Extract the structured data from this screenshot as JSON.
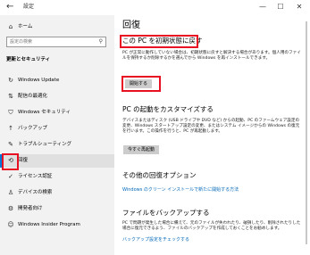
{
  "window": {
    "title": "設定",
    "back_glyph": "←",
    "minimize_glyph": "—",
    "maximize_glyph": "☐",
    "close_glyph": "✕"
  },
  "sidebar": {
    "home": {
      "label": "ホーム",
      "icon": "home-icon",
      "glyph": "⌂"
    },
    "search": {
      "placeholder": "設定の検索",
      "icon": "search-icon",
      "glyph": "⚲"
    },
    "section_title": "更新とセキュリティ",
    "items": [
      {
        "label": "Windows Update",
        "icon": "sync-icon",
        "glyph": "↻"
      },
      {
        "label": "配信の最適化",
        "icon": "delivery-optimization-icon",
        "glyph": "⇅"
      },
      {
        "label": "Windows セキュリティ",
        "icon": "shield-icon",
        "glyph": "⛉"
      },
      {
        "label": "バックアップ",
        "icon": "backup-arrow-icon",
        "glyph": "↑"
      },
      {
        "label": "トラブルシューティング",
        "icon": "wrench-icon",
        "glyph": "✎"
      },
      {
        "label": "回復",
        "icon": "recovery-icon",
        "glyph": "⟲",
        "selected": true
      },
      {
        "label": "ライセンス認証",
        "icon": "check-circle-icon",
        "glyph": "✓"
      },
      {
        "label": "デバイスの検索",
        "icon": "person-location-icon",
        "glyph": "♙"
      },
      {
        "label": "開発者向け",
        "icon": "developer-icon",
        "glyph": "⚙"
      },
      {
        "label": "Windows Insider Program",
        "icon": "insider-icon",
        "glyph": "☺"
      }
    ]
  },
  "main": {
    "title": "回復",
    "reset": {
      "heading": "この PC を初期状態に戻す",
      "description": "PC が正常に動作していない場合は、初期状態に戻すと解決する場合があります。個人用のファイルを保持するか削除するかを選んでから Windows を再インストールできます。",
      "button": "開始する"
    },
    "advanced_startup": {
      "heading": "PC の起動をカスタマイズする",
      "description": "デバイスまたはディスク (USB ドライブや DVD など) からの起動、PC のファームウェア設定の変更、Windows スタートアップ設定の変更、またはシステム イメージからの Windows の復元を行います。この操作を行うと、PC が再起動します。",
      "button": "今すぐ再起動"
    },
    "more_options": {
      "heading": "その他の回復オプション",
      "link": "Windows のクリーン インストールで新たに開始する方法"
    },
    "backup": {
      "heading": "ファイルをバックアップする",
      "description": "PC で問題が発生した場合に備えて、元のファイルが失われたり、破損したり、削除されたりした場合に復元できるよう、ファイルのバックアップを作成しておくことをお勧めします。",
      "link": "バックアップ設定をチェックする"
    }
  },
  "colors": {
    "accent": "#0078d7",
    "link": "#0067b8",
    "highlight": "#e81123",
    "sidebar_bg": "#f2f2f2",
    "button_bg": "#cccccc"
  }
}
